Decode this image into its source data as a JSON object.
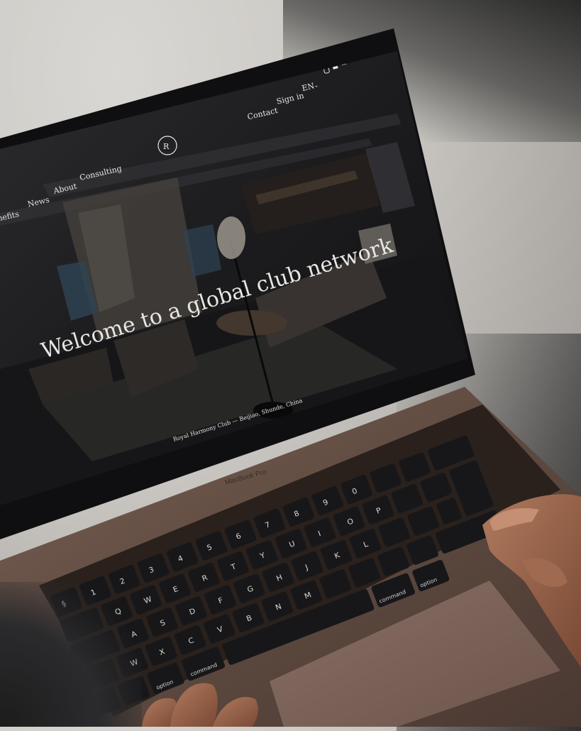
{
  "website": {
    "nav_left": [
      "nefits",
      "News",
      "About",
      "Consulting"
    ],
    "nav_right": [
      "Contact",
      "Sign in",
      "EN"
    ],
    "social_icons": [
      "instagram-icon",
      "facebook-icon",
      "linkedin-icon"
    ],
    "hero_title": "Welcome to a global club network",
    "caption": "Royal Harmony Club — Beijiao, Shunde, China"
  },
  "device": {
    "model_label": "MacBook Pro",
    "key_labels": {
      "command_left": "command",
      "command_right": "command",
      "option_right": "option",
      "option_left": "option"
    }
  },
  "colors": {
    "laptop_body": "#6b5448",
    "screen_bezel": "#121214",
    "key": "#17171a",
    "background": "#cfccc7"
  }
}
